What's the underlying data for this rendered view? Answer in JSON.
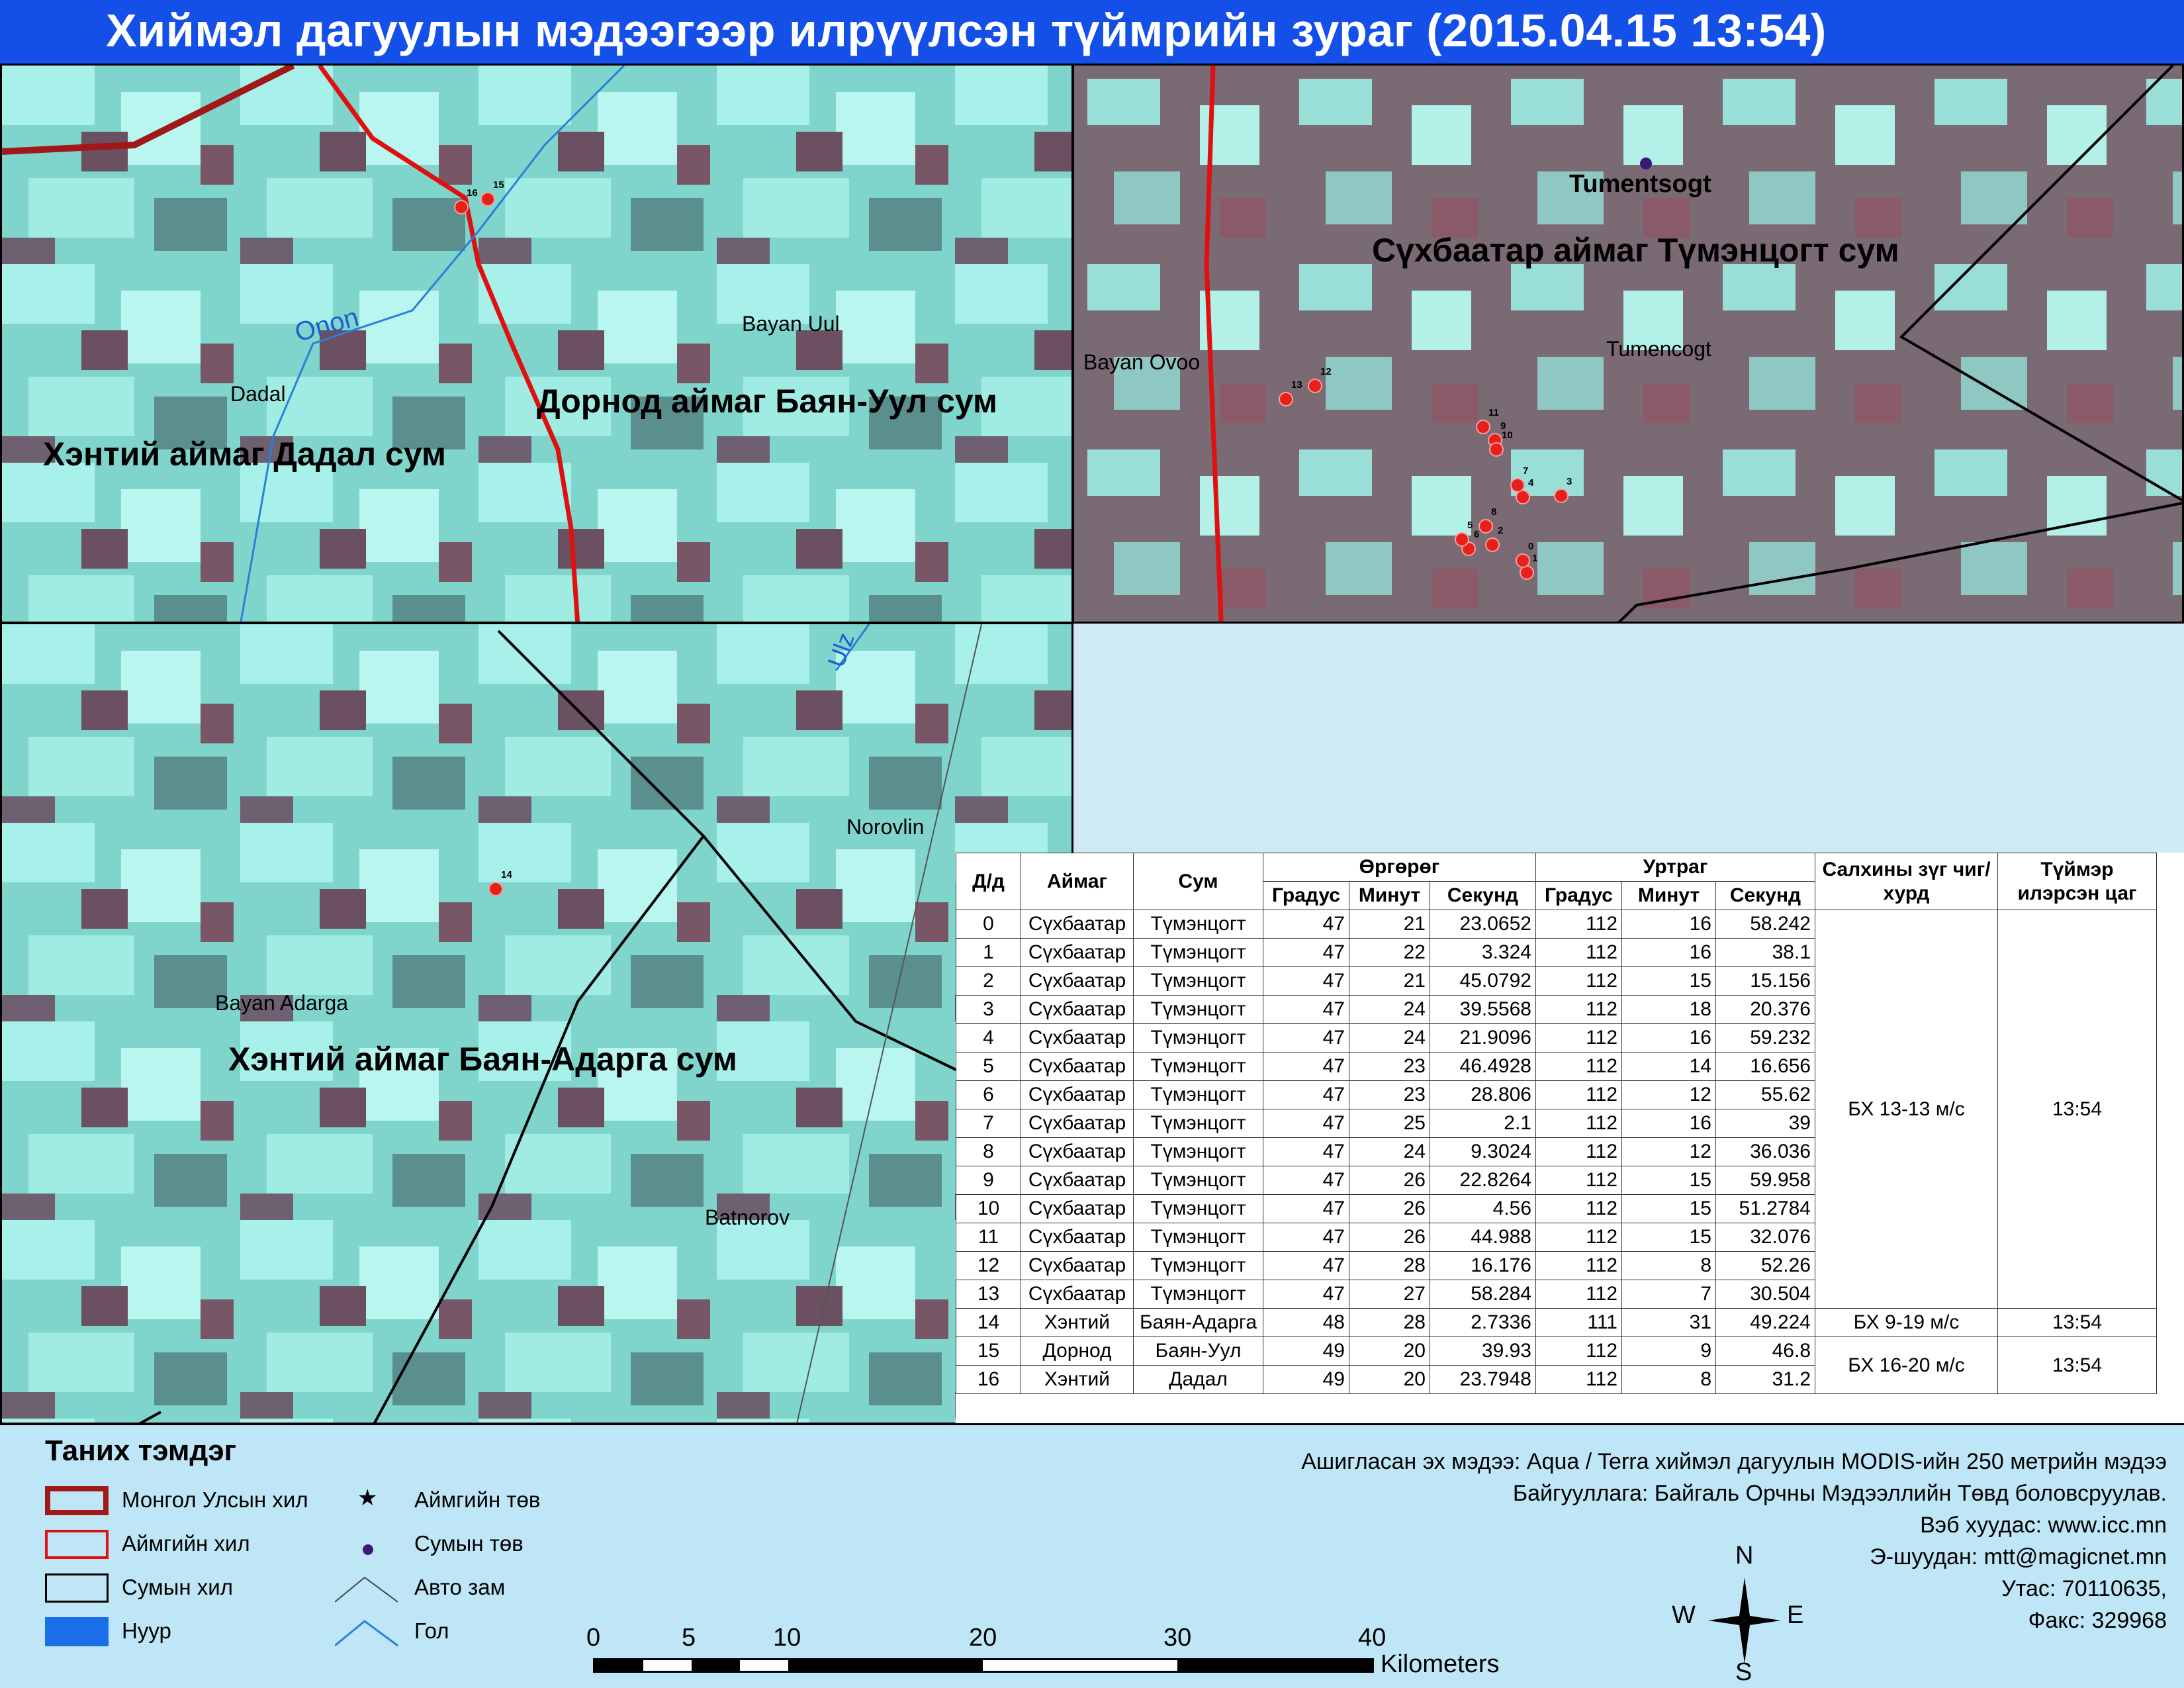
{
  "title": "Хиймэл дагуулын мэдээгээр илрүүлсэн түймрийн зураг  (2015.04.15 13:54)",
  "panels": {
    "top_left": {
      "region": "Хэнтий аймаг Дадал сум",
      "region2": "Дорнод аймаг Баян-Уул сум",
      "places": [
        "Dadal",
        "Bayan Uul"
      ],
      "river": "Onon",
      "fires": [
        "16",
        "15"
      ]
    },
    "top_right": {
      "region": "Сүхбаатар аймаг Түмэнцогт сум",
      "center": "Tumentsogt",
      "places": [
        "Bayan Ovoo",
        "Tumencogt"
      ],
      "fires": [
        "13",
        "12",
        "11",
        "9",
        "10",
        "7",
        "4",
        "3",
        "8",
        "6",
        "5",
        "2",
        "1",
        "0"
      ]
    },
    "bottom_left": {
      "region": "Хэнтий аймаг Баян-Адарга сум",
      "places": [
        "Norovlin",
        "Bayan Adarga",
        "Batnorov"
      ],
      "river": "Ulz",
      "fires": [
        "14"
      ]
    }
  },
  "table": {
    "headers": {
      "no": "Д/д",
      "aimag": "Аймаг",
      "sum": "Сум",
      "lat": "Өргөрөг",
      "lon": "Уртраг",
      "deg": "Градус",
      "min": "Минут",
      "sec": "Секунд",
      "wind": "Салхины зүг чиг/хурд",
      "time": "Түймэр илэрсэн цаг"
    },
    "rows": [
      [
        "0",
        "Сүхбаатар",
        "Түмэнцогт",
        "47",
        "21",
        "23.0652",
        "112",
        "16",
        "58.242"
      ],
      [
        "1",
        "Сүхбаатар",
        "Түмэнцогт",
        "47",
        "22",
        "3.324",
        "112",
        "16",
        "38.1"
      ],
      [
        "2",
        "Сүхбаатар",
        "Түмэнцогт",
        "47",
        "21",
        "45.0792",
        "112",
        "15",
        "15.156"
      ],
      [
        "3",
        "Сүхбаатар",
        "Түмэнцогт",
        "47",
        "24",
        "39.5568",
        "112",
        "18",
        "20.376"
      ],
      [
        "4",
        "Сүхбаатар",
        "Түмэнцогт",
        "47",
        "24",
        "21.9096",
        "112",
        "16",
        "59.232"
      ],
      [
        "5",
        "Сүхбаатар",
        "Түмэнцогт",
        "47",
        "23",
        "46.4928",
        "112",
        "14",
        "16.656"
      ],
      [
        "6",
        "Сүхбаатар",
        "Түмэнцогт",
        "47",
        "23",
        "28.806",
        "112",
        "12",
        "55.62"
      ],
      [
        "7",
        "Сүхбаатар",
        "Түмэнцогт",
        "47",
        "25",
        "2.1",
        "112",
        "16",
        "39"
      ],
      [
        "8",
        "Сүхбаатар",
        "Түмэнцогт",
        "47",
        "24",
        "9.3024",
        "112",
        "12",
        "36.036"
      ],
      [
        "9",
        "Сүхбаатар",
        "Түмэнцогт",
        "47",
        "26",
        "22.8264",
        "112",
        "15",
        "59.958"
      ],
      [
        "10",
        "Сүхбаатар",
        "Түмэнцогт",
        "47",
        "26",
        "4.56",
        "112",
        "15",
        "51.2784"
      ],
      [
        "11",
        "Сүхбаатар",
        "Түмэнцогт",
        "47",
        "26",
        "44.988",
        "112",
        "15",
        "32.076"
      ],
      [
        "12",
        "Сүхбаатар",
        "Түмэнцогт",
        "47",
        "28",
        "16.176",
        "112",
        "8",
        "52.26"
      ],
      [
        "13",
        "Сүхбаатар",
        "Түмэнцогт",
        "47",
        "27",
        "58.284",
        "112",
        "7",
        "30.504"
      ],
      [
        "14",
        "Хэнтий",
        "Баян-Адарга",
        "48",
        "28",
        "2.7336",
        "111",
        "31",
        "49.224"
      ],
      [
        "15",
        "Дорнод",
        "Баян-Уул",
        "49",
        "20",
        "39.93",
        "112",
        "9",
        "46.8"
      ],
      [
        "16",
        "Хэнтий",
        "Дадал",
        "49",
        "20",
        "23.7948",
        "112",
        "8",
        "31.2"
      ]
    ],
    "groups": [
      {
        "wind": "БХ 13-13 м/с",
        "time": "13:54",
        "rows": 14
      },
      {
        "wind": "БХ 9-19 м/с",
        "time": "13:54",
        "rows": 1
      },
      {
        "wind": "БХ 16-20 м/с",
        "time": "13:54",
        "rows": 2
      }
    ]
  },
  "legend": {
    "title": "Таних тэмдэг",
    "items": {
      "national": "Монгол Улсын хил",
      "aimag": "Аймгийн хил",
      "sum": "Сумын хил",
      "lake": "Нуур",
      "aimag_center": "Аймгийн төв",
      "sum_center": "Сумын төв",
      "road": "Авто зам",
      "river": "Гол"
    },
    "symbols": {
      "aimag_center": "★"
    }
  },
  "scale": {
    "ticks": [
      "0",
      "5",
      "10",
      "20",
      "30",
      "40"
    ],
    "unit": "Kilometers"
  },
  "compass": {
    "n": "N",
    "s": "S",
    "e": "E",
    "w": "W"
  },
  "source": {
    "line1": "Ашигласан эх мэдээ: Aqua / Terra хиймэл дагуулын MODIS-ийн 250 метрийн мэдээ",
    "line2": "Байгууллага: Байгаль Орчны Мэдээллийн Төвд боловсруулав.",
    "line3": "Вэб хуудас: www.icc.mn",
    "line4": "Э-шуудан: mtt@magicnet.mn",
    "line5": "Утас: 70110635,",
    "line6": "Факс: 329968"
  },
  "colors": {
    "title_bg": "#1450e8",
    "fire": "#e8201a",
    "aimag_border": "#e01010",
    "national_border": "#a01818",
    "river": "#2a7fd8",
    "lake": "#1a6fe8",
    "legend_bg": "#bfe6f7"
  }
}
